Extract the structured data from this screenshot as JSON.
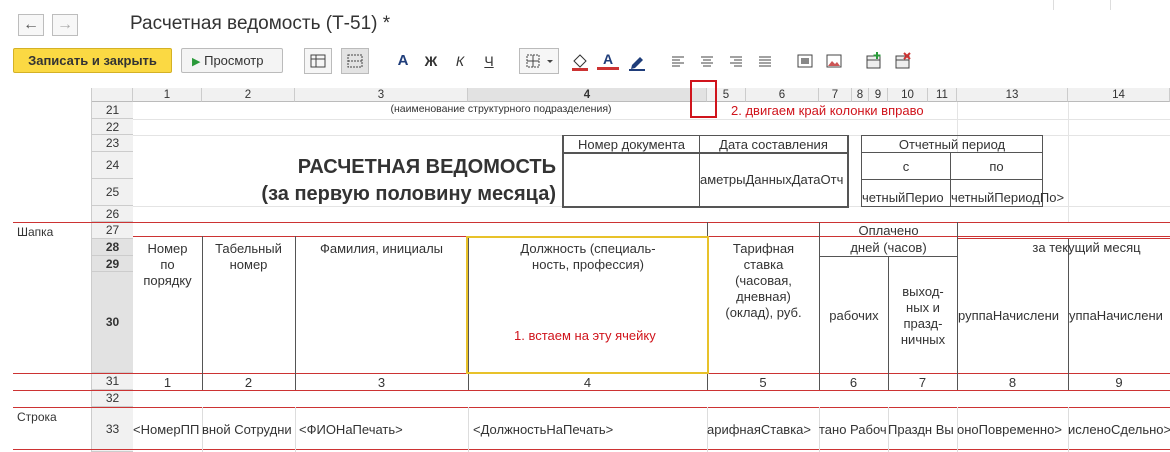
{
  "window": {
    "title": "Расчетная ведомость (Т-51) *"
  },
  "toolbar": {
    "back_icon": "arrow-left-icon",
    "forward_icon": "arrow-right-icon",
    "save_close_label": "Записать и закрыть",
    "preview_label": "Просмотр",
    "bold_label": "Ж",
    "italic_label": "К",
    "underline_label": "Ч",
    "font_color_label": "A",
    "font_label": "A"
  },
  "sheet": {
    "col_headers": [
      "1",
      "2",
      "3",
      "4",
      "5",
      "6",
      "7",
      "8",
      "9",
      "10",
      "11",
      "13",
      "14"
    ],
    "row_headers": [
      "21",
      "22",
      "23",
      "24",
      "25",
      "26",
      "27",
      "28",
      "29",
      "30",
      "31",
      "32",
      "33"
    ],
    "sections": {
      "header": "Шапка",
      "row": "Строка"
    },
    "cells": {
      "struct_unit": "(наименование структурного подразделения)",
      "doc_number": "Номер документа",
      "doc_date": "Дата составления",
      "period": "Отчетный период",
      "period_from": "с",
      "period_to": "по",
      "date_param": "аметрыДанныхДатаОтч",
      "period_start_param": "четныйПерио",
      "period_end_param": "четныйПериодПо>",
      "title_line1": "РАСЧЕТНАЯ ВЕДОМОСТЬ",
      "title_line2": "(за первую половину месяца)",
      "h_num": "Номер\nпо\nпорядку",
      "h_tab": "Табельный\nномер",
      "h_fio": "Фамилия, инициалы",
      "h_position": "Должность (специаль-\nность, профессия)",
      "h_rate": "Тарифная\nставка\n(часовая,\nдневная)\n(оклад), руб.",
      "h_paid": "Оплачено",
      "h_days": "дней (часов)",
      "h_current": "за текущий месяц",
      "h_working": "рабочих",
      "h_holidays": "выход-\nных и\nпразд-\nничных",
      "h_group1": "руппаНачислени",
      "h_group2": "уппаНачислени",
      "col_nums": [
        "1",
        "2",
        "3",
        "4",
        "5",
        "6",
        "7",
        "8",
        "9"
      ],
      "r33": [
        "<НомерПП",
        "вной Сотрудни",
        "<ФИОНаПечать>",
        "<ДолжностьНаПечать>",
        "арифнаяСтавка>",
        "тано Рабоч",
        "Праздн Вы",
        "оноПовременно>",
        "исленоСдельно>"
      ]
    }
  },
  "annotations": {
    "note1": "1. встаем на эту ячейку",
    "note2": "2. двигаем край колонки вправо"
  },
  "colors": {
    "accent": "#fbd943",
    "border_red": "#cc3333",
    "note_red": "#d0141c",
    "highlight_yellow": "#e8c22a"
  }
}
